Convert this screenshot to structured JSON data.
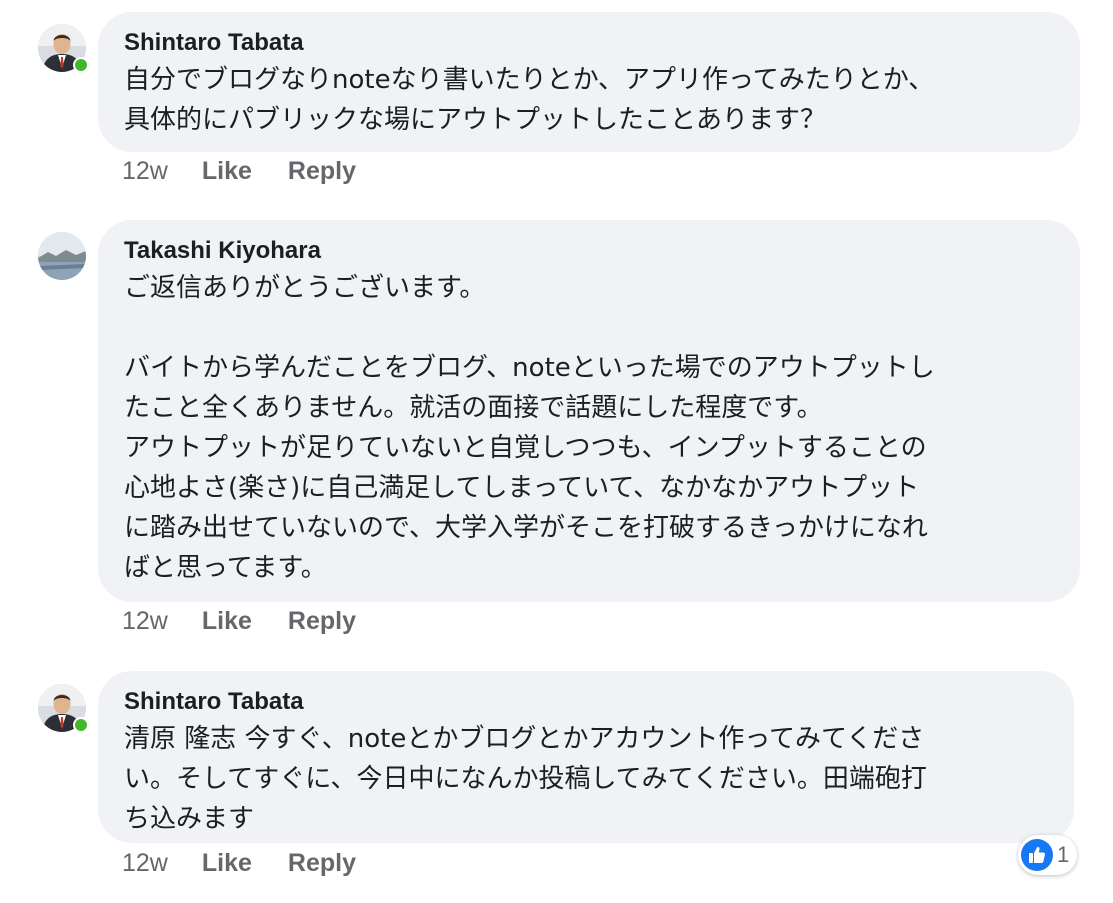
{
  "comments": [
    {
      "author": "Shintaro Tabata",
      "avatar_icon": "profile-photo-man-in-suit",
      "online": true,
      "text": "自分でブログなりnoteなり書いたりとか、アプリ作ってみたりとか、\n具体的にパブリックな場にアウトプットしたことあります？",
      "time": "12w",
      "like_label": "Like",
      "reply_label": "Reply"
    },
    {
      "author": "Takashi Kiyohara",
      "avatar_icon": "profile-photo-landscape",
      "online": false,
      "text": "ご返信ありがとうございます。\n\nバイトから学んだことをブログ、noteといった場でのアウトプットし\nたこと全くありません。就活の面接で話題にした程度です。\nアウトプットが足りていないと自覚しつつも、インプットすることの\n心地よさ(楽さ)に自己満足してしまっていて、なかなかアウトプット\nに踏み出せていないので、大学入学がそこを打破するきっかけになれ\nばと思ってます。",
      "time": "12w",
      "like_label": "Like",
      "reply_label": "Reply"
    },
    {
      "author": "Shintaro Tabata",
      "avatar_icon": "profile-photo-man-in-suit",
      "online": true,
      "text": "清原 隆志 今すぐ、noteとかブログとかアカウント作ってみてくださ\nい。そしてすぐに、今日中になんか投稿してみてください。田端砲打\nち込みます",
      "time": "12w",
      "like_label": "Like",
      "reply_label": "Reply"
    }
  ],
  "reaction": {
    "icon": "thumbs-up-icon",
    "count": "1",
    "color": "#1877f2"
  },
  "colors": {
    "bubble": "#f0f2f5",
    "muted": "#65676b",
    "online": "#42b72a"
  }
}
